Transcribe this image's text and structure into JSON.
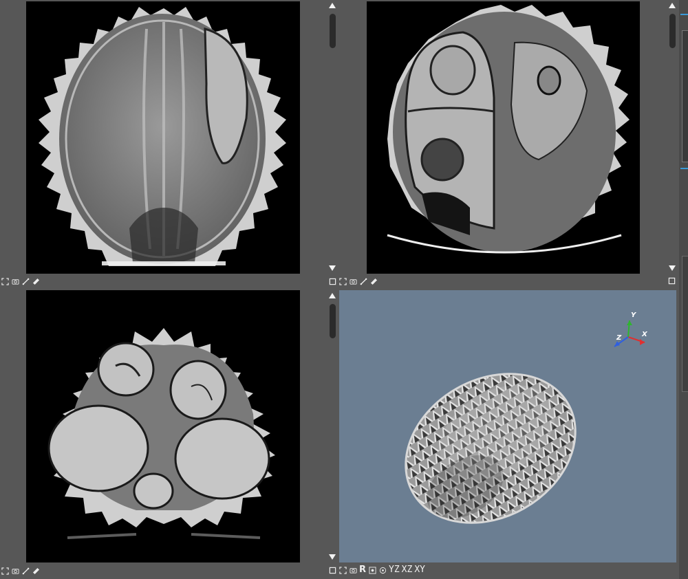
{
  "layout": {
    "views": [
      "slice-view-top-left",
      "slice-view-top-right",
      "slice-view-bottom-left",
      "volume-3d-view"
    ]
  },
  "views": {
    "top_left": {
      "kind": "slice",
      "toolbar": [
        "fit-to-view-icon",
        "camera-icon",
        "measure-icon",
        "ruler-icon"
      ]
    },
    "top_right": {
      "kind": "slice",
      "toolbar": [
        "maximize-icon",
        "fit-to-view-icon",
        "camera-icon",
        "measure-icon",
        "ruler-icon"
      ]
    },
    "bottom_left": {
      "kind": "slice",
      "toolbar": [
        "fit-to-view-icon",
        "camera-icon",
        "measure-icon",
        "ruler-icon"
      ]
    },
    "volume_3d": {
      "kind": "3d",
      "background_color": "#6b7e92",
      "axes": {
        "x": "X",
        "y": "Y",
        "z": "Z"
      },
      "toolbar": {
        "reset_label": "R",
        "yz_label": "YZ",
        "xz_label": "XZ",
        "xy_label": "XY"
      }
    }
  },
  "colors": {
    "panel_bg": "#575757",
    "slice_bg": "#000000",
    "axis_x": "#e03030",
    "axis_y": "#2fb52f",
    "axis_z": "#2f5fe0"
  }
}
